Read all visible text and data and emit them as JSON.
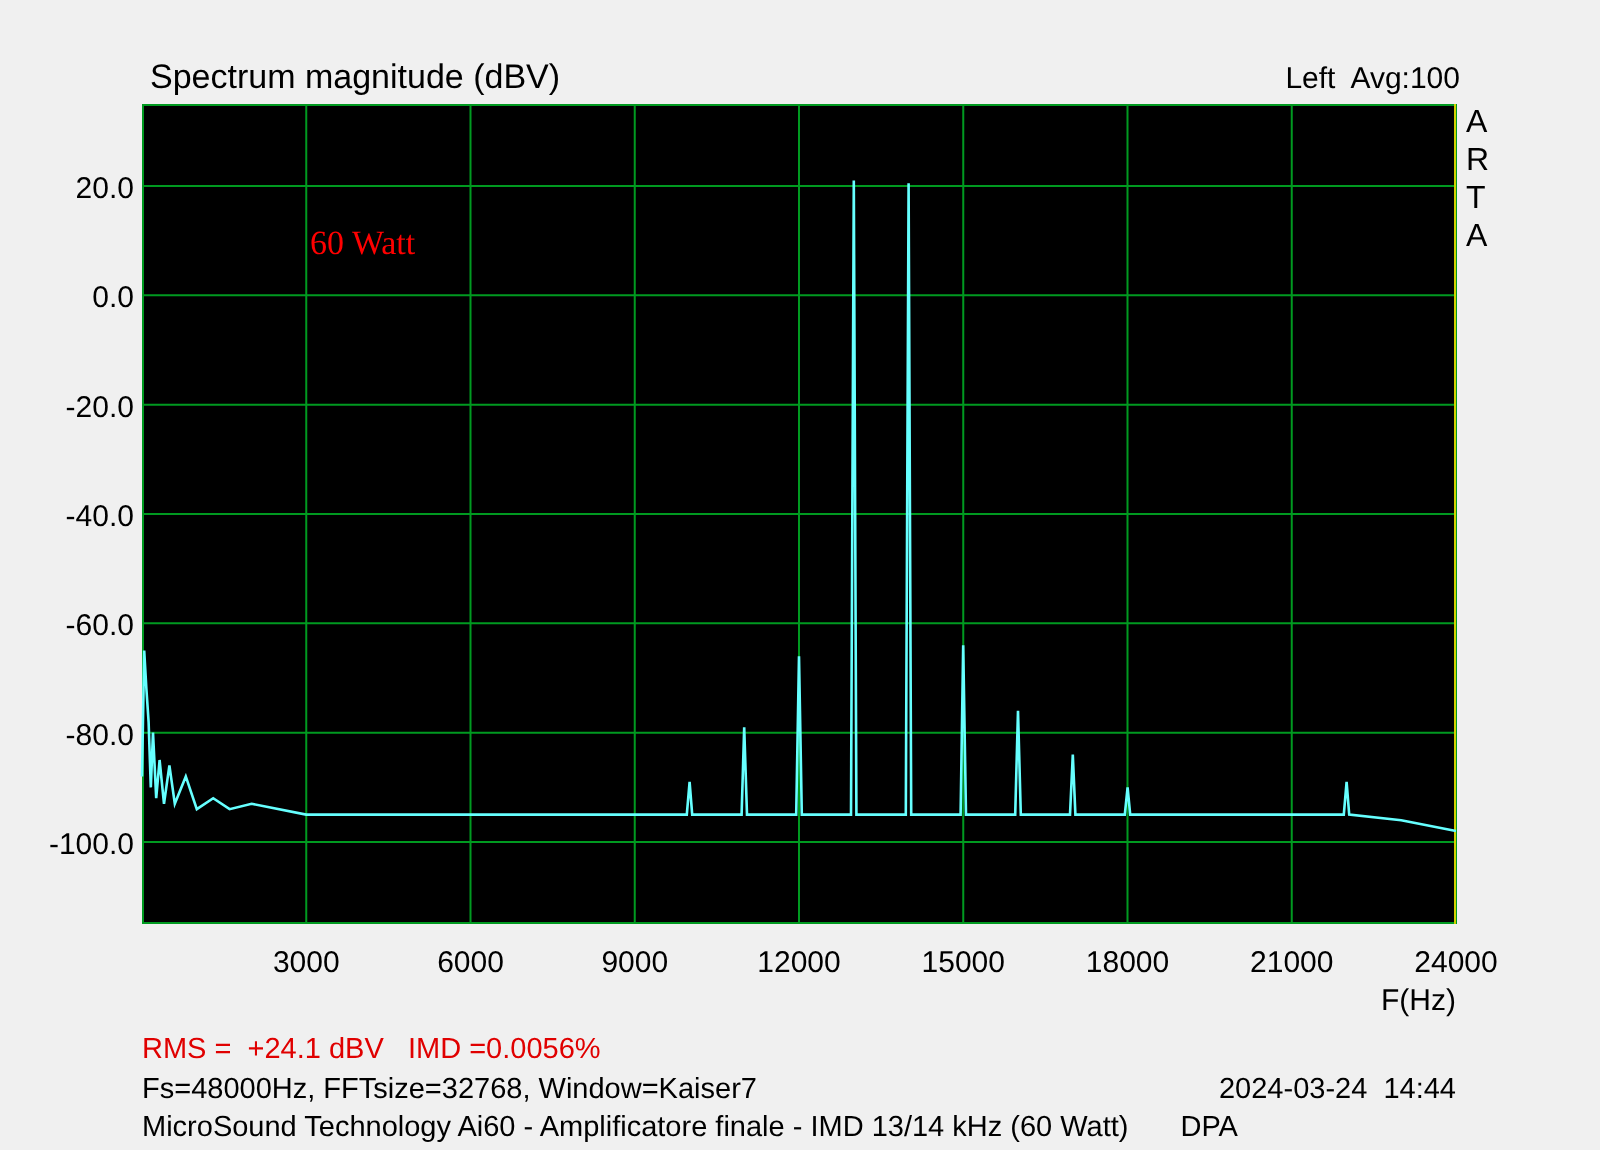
{
  "header": {
    "average": "Avg:100"
  },
  "logo": "ARTA",
  "chart_data": {
    "type": "line",
    "title": "Spectrum magnitude (dBV)",
    "xlabel": "F(Hz)",
    "grid": true,
    "xlim": [
      0,
      24000
    ],
    "ylim": [
      -115,
      35
    ],
    "xticks": [
      3000,
      6000,
      9000,
      12000,
      15000,
      18000,
      21000,
      24000
    ],
    "yticks": [
      {
        "value": 20,
        "label": "20.0"
      },
      {
        "value": 0,
        "label": "0.0"
      },
      {
        "value": -20,
        "label": "-20.0"
      },
      {
        "value": -40,
        "label": "-40.0"
      },
      {
        "value": -60,
        "label": "-60.0"
      },
      {
        "value": -80,
        "label": "-80.0"
      },
      {
        "value": -100,
        "label": "-100.0"
      }
    ],
    "x": [
      0,
      40,
      80,
      120,
      160,
      200,
      260,
      320,
      400,
      500,
      600,
      800,
      1000,
      1300,
      1600,
      2000,
      3000,
      5000,
      7000,
      9000,
      9950,
      10000,
      10050,
      10950,
      11000,
      11050,
      11950,
      12000,
      12050,
      12950,
      13000,
      13050,
      13950,
      14000,
      14050,
      14950,
      15000,
      15050,
      15950,
      16000,
      16050,
      16950,
      17000,
      17050,
      17950,
      18000,
      18050,
      21950,
      22000,
      22050,
      23000,
      24000
    ],
    "series": [
      {
        "name": "Left",
        "color": "#66ffff",
        "values": [
          -88,
          -65,
          -72,
          -78,
          -90,
          -80,
          -92,
          -85,
          -93,
          -86,
          -93,
          -88,
          -94,
          -92,
          -94,
          -93,
          -95,
          -95,
          -95,
          -95,
          -95,
          -89,
          -95,
          -95,
          -79,
          -95,
          -95,
          -66,
          -95,
          -95,
          21,
          -95,
          -95,
          20.5,
          -95,
          -95,
          -64,
          -95,
          -95,
          -76,
          -95,
          -95,
          -84,
          -95,
          -95,
          -90,
          -95,
          -95,
          -89,
          -95,
          -96,
          -98
        ]
      }
    ],
    "annotations": [
      {
        "text": "60 Watt"
      }
    ]
  },
  "footer": {
    "measurement": "RMS =  +24.1 dBV   IMD =0.0056%",
    "settings": "Fs=48000Hz, FFTsize=32768, Window=Kaiser7",
    "timestamp": "2024-03-24  14:44",
    "description": "MicroSound Technology Ai60 - Amplificatore finale - IMD 13/14 kHz (60 Watt)",
    "author": "DPA"
  }
}
